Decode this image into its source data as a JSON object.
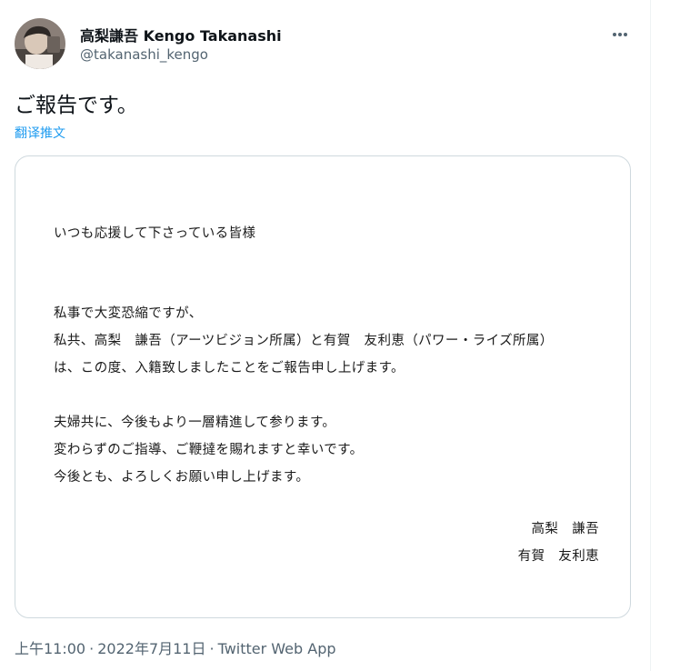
{
  "author": {
    "display_name": "高梨謙吾 Kengo Takanashi",
    "handle": "@takanashi_kengo",
    "avatar_icon": "profile-photo",
    "more_icon": "more-horizontal-icon"
  },
  "tweet": {
    "text": "ご報告です。",
    "translate_label": "翻译推文"
  },
  "letter": {
    "greeting": "いつも応援して下さっている皆様",
    "body_lines": [
      "私事で大変恐縮ですが、",
      "私共、高梨　謙吾（アーツビジョン所属）と有賀　友利恵（パワー・ライズ所属）",
      "は、この度、入籍致しましたことをご報告申し上げます。",
      "夫婦共に、今後もより一層精進して参ります。",
      "変わらずのご指導、ご鞭撻を賜れますと幸いです。",
      "今後とも、よろしくお願い申し上げます。"
    ],
    "signatures": [
      "高梨　謙吾",
      "有賀　友利恵"
    ]
  },
  "meta": {
    "time": "上午11:00",
    "separator": "·",
    "date": "2022年7月11日",
    "source": "Twitter Web App"
  },
  "colors": {
    "text": "#0f1419",
    "secondary": "#536471",
    "link": "#1d9bf0",
    "border": "#cfd9de"
  }
}
